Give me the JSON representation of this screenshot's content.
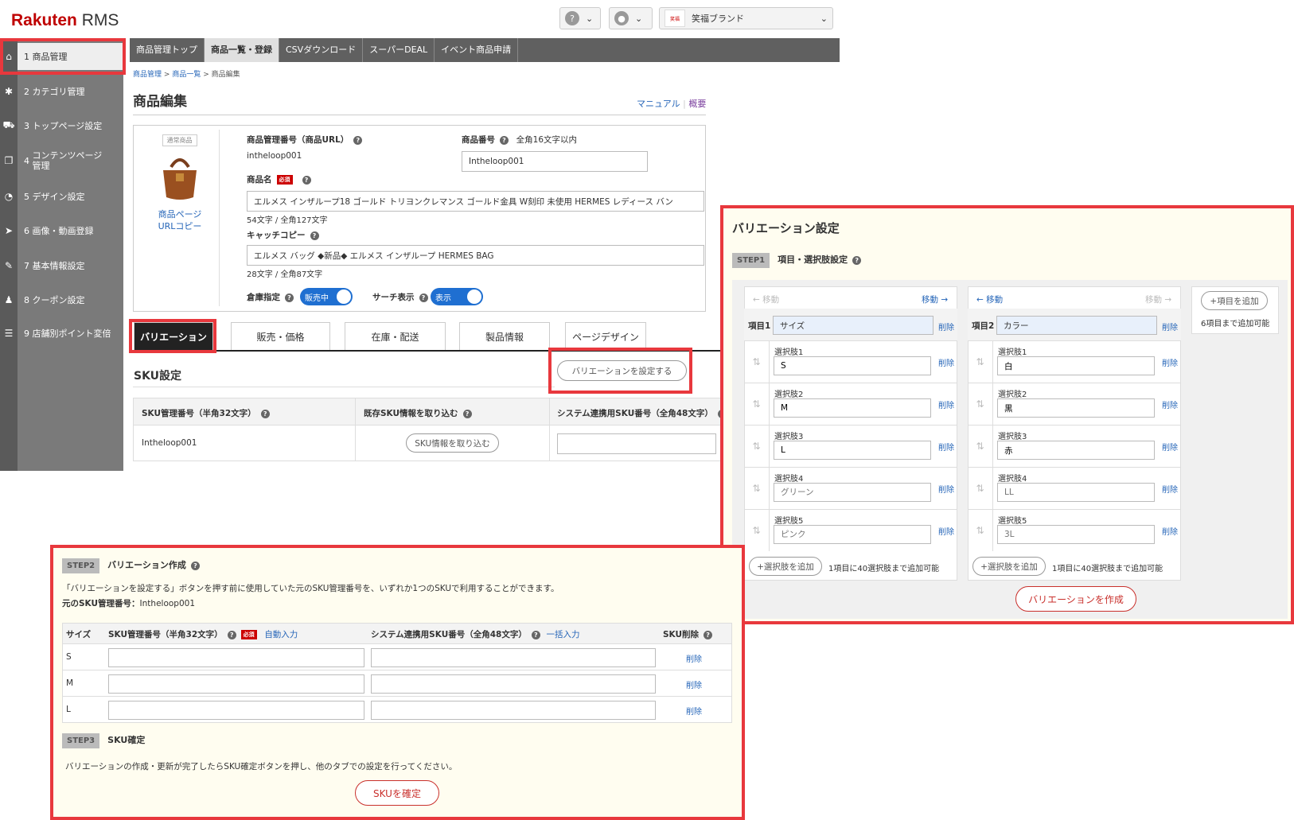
{
  "brand": {
    "name": "Rakuten",
    "suffix": "RMS"
  },
  "header": {
    "shop_name": "笑福ブランド",
    "help_icon": "question-icon",
    "user_icon": "user-icon"
  },
  "sidebar": {
    "items": [
      {
        "num": "1",
        "label": "商品管理",
        "icon": "home-icon"
      },
      {
        "num": "2",
        "label": "カテゴリ管理",
        "icon": "gear-icon"
      },
      {
        "num": "3",
        "label": "トップページ設定",
        "icon": "cart-icon"
      },
      {
        "num": "4",
        "label": "コンテンツページ管理",
        "icon": "pages-icon"
      },
      {
        "num": "5",
        "label": "デザイン設定",
        "icon": "palette-icon"
      },
      {
        "num": "6",
        "label": "画像・動画登録",
        "icon": "send-icon"
      },
      {
        "num": "7",
        "label": "基本情報設定",
        "icon": "wrench-icon"
      },
      {
        "num": "8",
        "label": "クーポン設定",
        "icon": "users-icon"
      },
      {
        "num": "9",
        "label": "店舗別ポイント変倍",
        "icon": "list-icon"
      }
    ]
  },
  "topnav": [
    "商品管理トップ",
    "商品一覧・登録",
    "CSVダウンロード",
    "スーパーDEAL",
    "イベント商品申請"
  ],
  "breadcrumb": [
    "商品管理",
    "商品一覧",
    "商品編集"
  ],
  "breadcrumb_sep": ">",
  "page_title": "商品編集",
  "links": {
    "manual": "マニュアル",
    "summary": "概要"
  },
  "product": {
    "badge": "通常商品",
    "url_copy": "商品ページURLコピー",
    "mgmt_label": "商品管理番号（商品URL）",
    "mgmt_value": "intheloop001",
    "number_label": "商品番号",
    "number_hint": "全角16文字以内",
    "number_value": "Intheloop001",
    "name_label": "商品名",
    "required": "必須",
    "name_value": "エルメス インザループ18 ゴールド トリヨンクレマンス ゴールド金具 W刻印 未使用 HERMES レディース バン",
    "name_count": "54文字 / 全角127文字",
    "catch_label": "キャッチコピー",
    "catch_value": "エルメス バッグ ◆新品◆ エルメス インザループ HERMES BAG",
    "catch_count": "28文字 / 全角87文字",
    "warehouse_label": "倉庫指定",
    "warehouse_toggle": "販売中",
    "search_label": "サーチ表示",
    "search_toggle": "表示"
  },
  "tabs": [
    "バリエーション",
    "販売・価格",
    "在庫・配送",
    "製品情報",
    "ページデザイン"
  ],
  "sku": {
    "title": "SKU設定",
    "set_variation_button": "バリエーションを設定する",
    "col1": "SKU管理番号（半角32文字）",
    "col2": "既存SKU情報を取り込む",
    "col3": "システム連携用SKU番号（全角48文字）",
    "row_value": "Intheloop001",
    "import_button": "SKU情報を取り込む"
  },
  "variation": {
    "title": "バリエーション設定",
    "step1": "STEP1",
    "step1_title": "項目・選択肢設定",
    "move_prev": "移動",
    "move_next": "移動",
    "item1_label": "項目1",
    "item1_value": "サイズ",
    "item2_label": "項目2",
    "item2_value": "カラー",
    "delete": "削除",
    "choices1": [
      {
        "label": "選択肢1",
        "value": "S",
        "placeholder": ""
      },
      {
        "label": "選択肢2",
        "value": "M",
        "placeholder": ""
      },
      {
        "label": "選択肢3",
        "value": "L",
        "placeholder": ""
      },
      {
        "label": "選択肢4",
        "value": "",
        "placeholder": "グリーン"
      },
      {
        "label": "選択肢5",
        "value": "",
        "placeholder": "ピンク"
      }
    ],
    "choices2": [
      {
        "label": "選択肢1",
        "value": "白",
        "placeholder": ""
      },
      {
        "label": "選択肢2",
        "value": "黒",
        "placeholder": ""
      },
      {
        "label": "選択肢3",
        "value": "赤",
        "placeholder": ""
      },
      {
        "label": "選択肢4",
        "value": "",
        "placeholder": "LL"
      },
      {
        "label": "選択肢5",
        "value": "",
        "placeholder": "3L"
      }
    ],
    "add_choice": "+選択肢を追加",
    "add_choice_note": "1項目に40選択肢まで追加可能",
    "add_item": "+項目を追加",
    "add_item_note": "6項目まで追加可能",
    "create_button": "バリエーションを作成"
  },
  "step2": {
    "step": "STEP2",
    "title": "バリエーション作成",
    "desc": "「バリエーションを設定する」ボタンを押す前に使用していた元のSKU管理番号を、いずれか1つのSKUで利用することができます。",
    "orig_label": "元のSKU管理番号：",
    "orig_value": "Intheloop001",
    "col_size": "サイズ",
    "col_sku": "SKU管理番号（半角32文字）",
    "auto_input": "自動入力",
    "col_sys": "システム連携用SKU番号（全角48文字）",
    "bulk_input": "一括入力",
    "col_del": "SKU削除",
    "rows": [
      "S",
      "M",
      "L"
    ],
    "delete": "削除"
  },
  "step3": {
    "step": "STEP3",
    "title": "SKU確定",
    "desc": "バリエーションの作成・更新が完了したらSKU確定ボタンを押し、他のタブでの設定を行ってください。",
    "button": "SKUを確定"
  },
  "colors": {
    "accent": "#e8383d",
    "brand": "#bf0000",
    "link": "#2565b8",
    "toggle": "#1f6fd1"
  }
}
